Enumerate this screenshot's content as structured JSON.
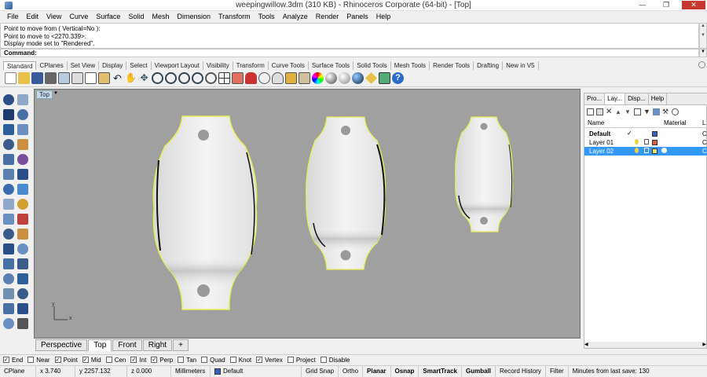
{
  "window": {
    "title": "weepingwillow.3dm (310 KB) - Rhinoceros Corporate (64-bit) - [Top]",
    "minimize": "—",
    "maximize": "❐",
    "close": "✕"
  },
  "menu": [
    "File",
    "Edit",
    "View",
    "Curve",
    "Surface",
    "Solid",
    "Mesh",
    "Dimension",
    "Transform",
    "Tools",
    "Analyze",
    "Render",
    "Panels",
    "Help"
  ],
  "command_history": [
    "Point to move from ( Vertical=No ):",
    "Point to move to <2270.339>:",
    "Display mode set to \"Rendered\"."
  ],
  "command": {
    "label": "Command:",
    "value": ""
  },
  "toolbar_tabs": [
    "Standard",
    "CPlanes",
    "Set View",
    "Display",
    "Select",
    "Viewport Layout",
    "Visibility",
    "Transform",
    "Curve Tools",
    "Surface Tools",
    "Solid Tools",
    "Mesh Tools",
    "Render Tools",
    "Drafting",
    "New in V5"
  ],
  "toolbar_icons": [
    "new-icon",
    "open-icon",
    "save-icon",
    "print-icon",
    "import-icon",
    "cut-icon",
    "copy-icon",
    "paste-icon",
    "undo-icon",
    "pan-icon",
    "rotate-view-icon",
    "zoom-icon",
    "zoom-window-icon",
    "zoom-extents-icon",
    "zoom-selected-icon",
    "undo-view-icon",
    "four-viewports-icon",
    "grid-icon",
    "car-icon",
    "options-icon",
    "lights-icon",
    "lock-icon",
    "layers-icon",
    "color-icon",
    "material-icon",
    "render-sphere-icon",
    "render-icon",
    "object-snap-icon",
    "history-icon",
    "help-icon"
  ],
  "viewport": {
    "name": "Top",
    "axis_x": "x",
    "axis_y": "y"
  },
  "viewport_tabs": [
    "Perspective",
    "Top",
    "Front",
    "Right"
  ],
  "viewport_add": "+",
  "panel": {
    "tabs": [
      "Pro...",
      "Lay...",
      "Disp...",
      "Help"
    ],
    "columns": {
      "name": "Name",
      "material": "Material",
      "extra": "L"
    },
    "layers": [
      {
        "name": "Default",
        "current": "✓",
        "color": "#3a5fbf",
        "selected": false,
        "extra": "C"
      },
      {
        "name": "Layer 01",
        "current": "",
        "color": "#e05a3c",
        "selected": false,
        "extra": "C"
      },
      {
        "name": "Layer 02",
        "current": "",
        "color": "#f0e070",
        "selected": true,
        "extra": "C"
      }
    ]
  },
  "osnaps": [
    {
      "label": "End",
      "checked": true
    },
    {
      "label": "Near",
      "checked": false
    },
    {
      "label": "Point",
      "checked": true
    },
    {
      "label": "Mid",
      "checked": true
    },
    {
      "label": "Cen",
      "checked": false
    },
    {
      "label": "Int",
      "checked": true
    },
    {
      "label": "Perp",
      "checked": true
    },
    {
      "label": "Tan",
      "checked": false
    },
    {
      "label": "Quad",
      "checked": false
    },
    {
      "label": "Knot",
      "checked": false
    },
    {
      "label": "Vertex",
      "checked": true
    },
    {
      "label": "Project",
      "checked": false
    },
    {
      "label": "Disable",
      "checked": false
    }
  ],
  "status": {
    "cplane": "CPlane",
    "x": "x 3.740",
    "y": "y 2257.132",
    "z": "z 0.000",
    "units": "Millimeters",
    "layer": "Default",
    "grid_snap": "Grid Snap",
    "ortho": "Ortho",
    "planar": "Planar",
    "osnap": "Osnap",
    "smarttrack": "SmartTrack",
    "gumball": "Gumball",
    "record_history": "Record History",
    "filter": "Filter",
    "last_save": "Minutes from last save: 130"
  },
  "colors": {
    "viewport_bg": "#a0a0a0",
    "selection_outline": "#e8ef50",
    "selected_row": "#3399ff"
  }
}
